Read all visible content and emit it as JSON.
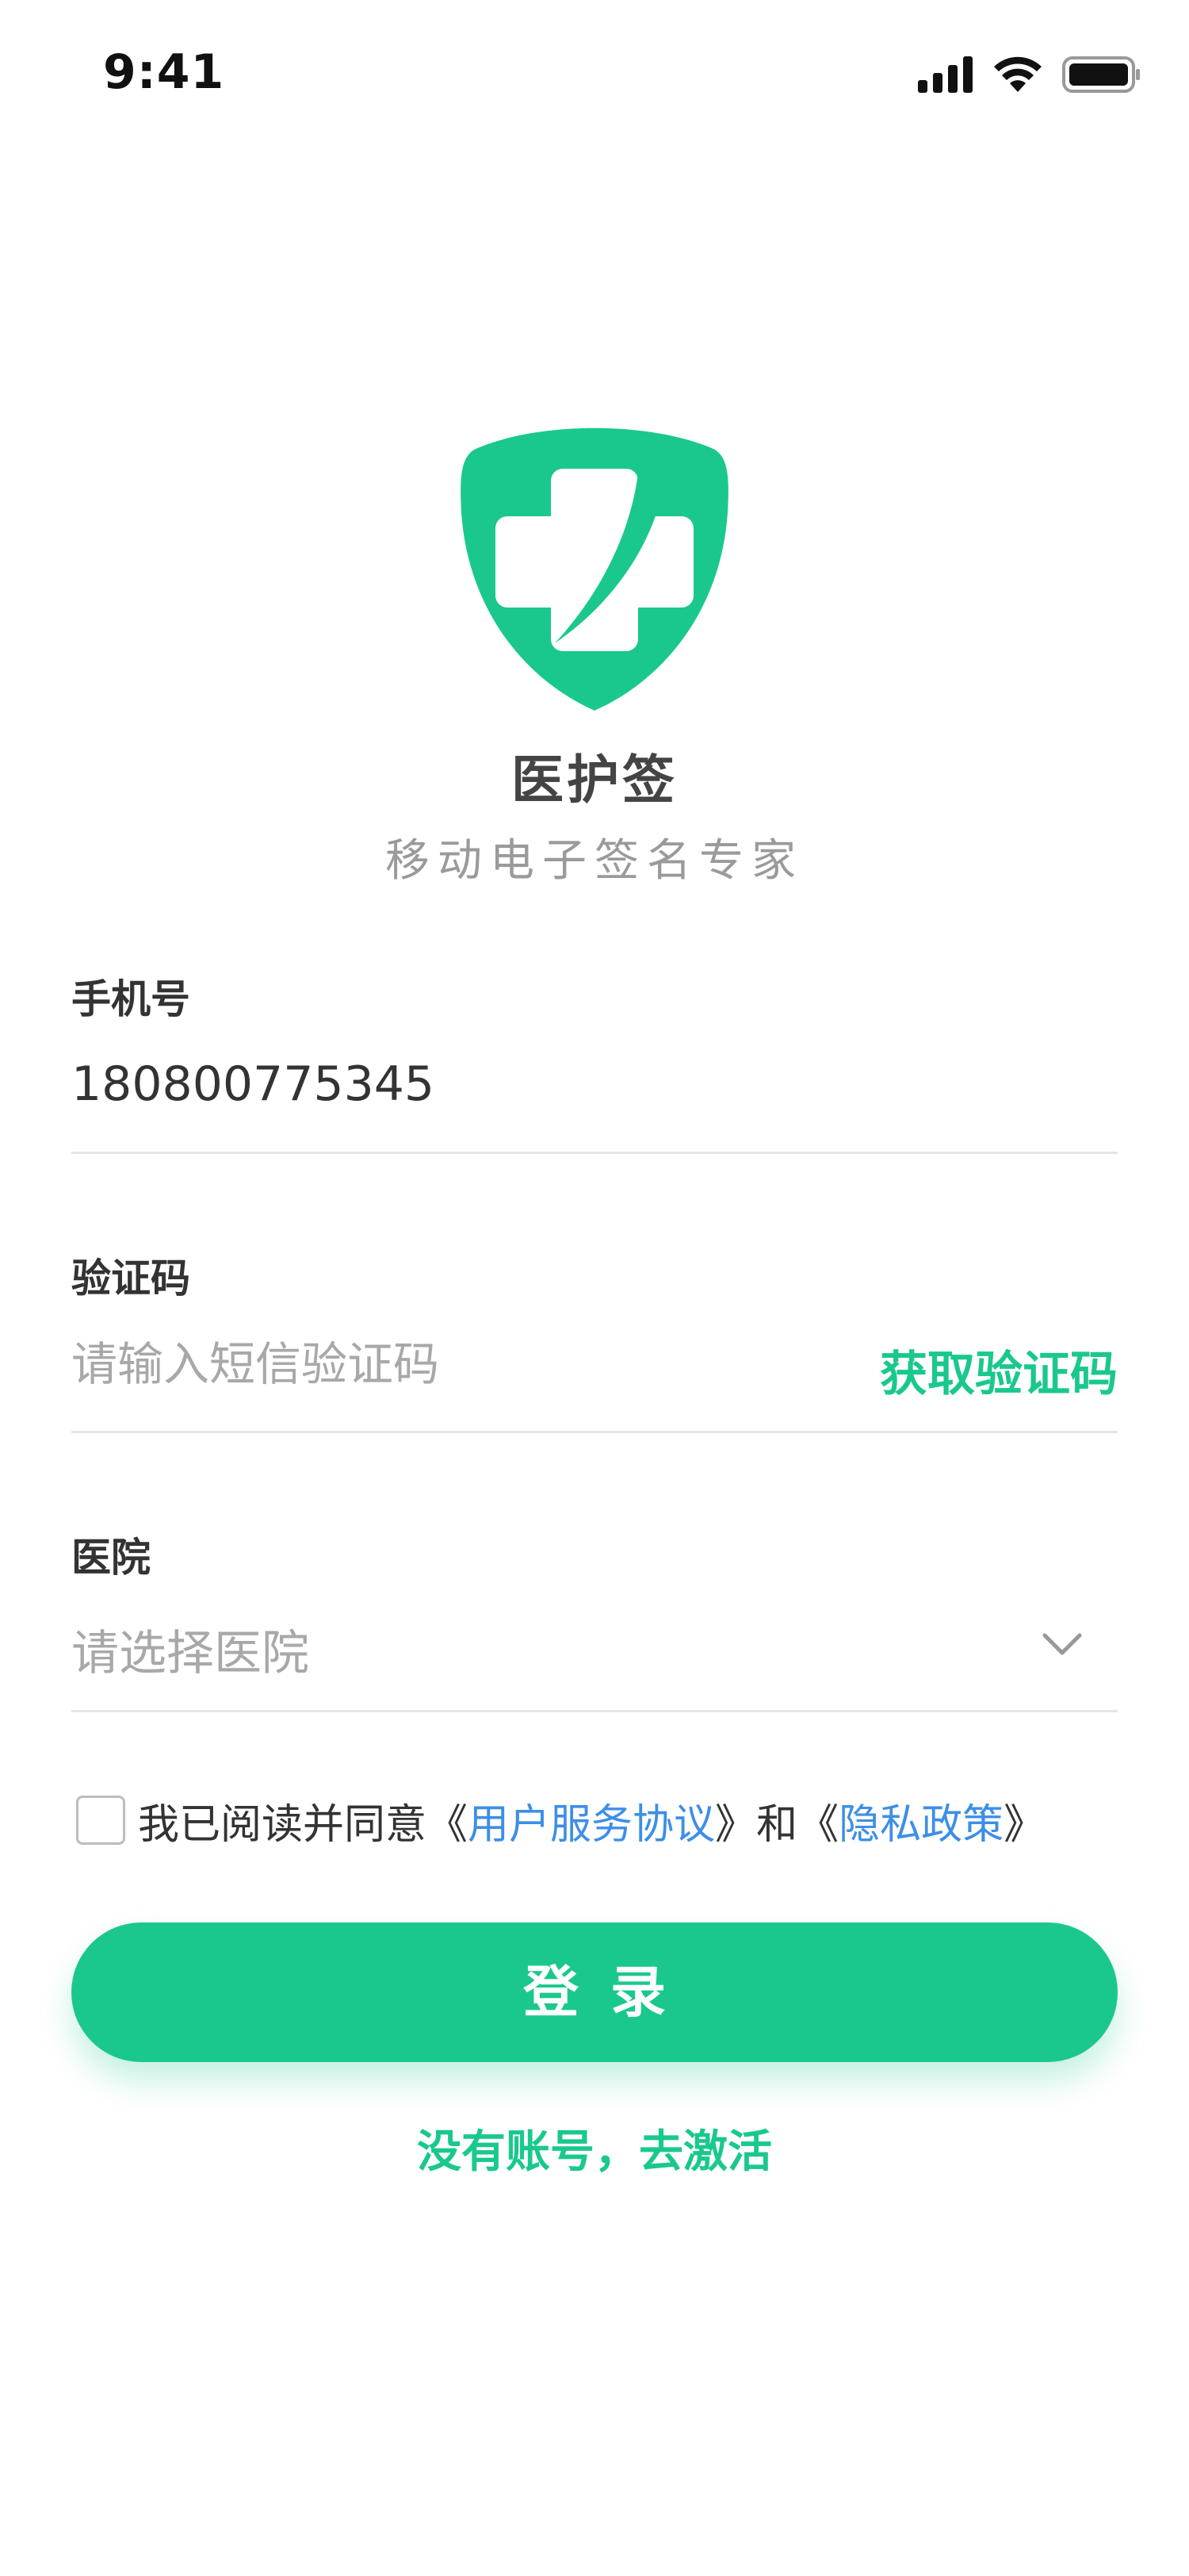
{
  "status_bar": {
    "time": "9:41"
  },
  "app": {
    "name": "医护签",
    "slogan": "移动电子签名专家",
    "brand_color": "#1ac88e"
  },
  "phone_field": {
    "label": "手机号",
    "value": "180800775345"
  },
  "code_field": {
    "label": "验证码",
    "placeholder": "请输入短信验证码",
    "get_code_label": "获取验证码"
  },
  "hospital_field": {
    "label": "医院",
    "placeholder": "请选择医院",
    "icon": "chevron-down-icon"
  },
  "agreement": {
    "checked": false,
    "prefix": "我已阅读并同意",
    "open_quote": "《",
    "close_quote": "》",
    "user_agreement": "用户服务协议",
    "and": "和",
    "privacy_policy": "隐私政策",
    "link_color": "#3d8fe6"
  },
  "login_button": {
    "label": "登录"
  },
  "activate_link": {
    "label": "没有账号，去激活"
  }
}
